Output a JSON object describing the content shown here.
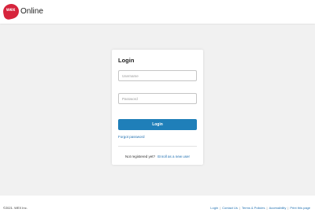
{
  "header": {
    "logo_mark_text": "wex",
    "logo_text": "Online"
  },
  "login_card": {
    "title": "Login",
    "username_placeholder": "Username",
    "password_placeholder": "Password",
    "login_button": "Login",
    "forgot_password": "Forgot password",
    "not_registered": "Not registered yet?",
    "enroll_link": "Enroll as a new user"
  },
  "footer": {
    "copyright": "©2021. WEX Inc.",
    "links": [
      "Login",
      "Contact Us",
      "Terms & Policies",
      "Accessibility",
      "Print this page"
    ],
    "separator": "|"
  },
  "colors": {
    "brand_red": "#d6243c",
    "primary_blue": "#1f7fb9",
    "link_blue": "#1f6fb0",
    "page_background": "#f1f1f1"
  }
}
